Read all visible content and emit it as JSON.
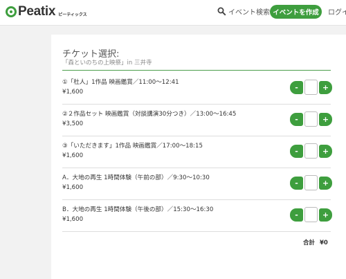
{
  "header": {
    "logo_text": "Peatix",
    "logo_sub": "ピーティックス",
    "search_label": "イベント検索",
    "create_button": "イベントを作成",
    "login_label": "ログイン"
  },
  "ticket_panel": {
    "title": "チケット選択:",
    "subtitle": "「森といのちの上映祭」in 三井寺",
    "tickets": [
      {
        "name": "①「杜人」1作品 映画鑑賞／11:00〜12:41",
        "price": "¥1,600",
        "quantity": ""
      },
      {
        "name": "②２作品セット 映画鑑賞（対談講演30分つき）／13:00〜16:45",
        "price": "¥3,500",
        "quantity": ""
      },
      {
        "name": "③「いただきます」1作品 映画鑑賞／17:00〜18:15",
        "price": "¥1,600",
        "quantity": ""
      },
      {
        "name": "A．大地の再生 1時間体験（午前の部）／9:30〜10:30",
        "price": "¥1,600",
        "quantity": ""
      },
      {
        "name": "B．大地の再生 1時間体験（午後の部）／15:30〜16:30",
        "price": "¥1,600",
        "quantity": ""
      }
    ],
    "minus_symbol": "-",
    "plus_symbol": "+",
    "total_label": "合計",
    "total_value": "¥0"
  },
  "colors": {
    "accent": "#3e9e3e",
    "background": "#f2f2f2"
  },
  "icons": {
    "logo": "peatix-logo-icon",
    "search": "search-icon"
  }
}
